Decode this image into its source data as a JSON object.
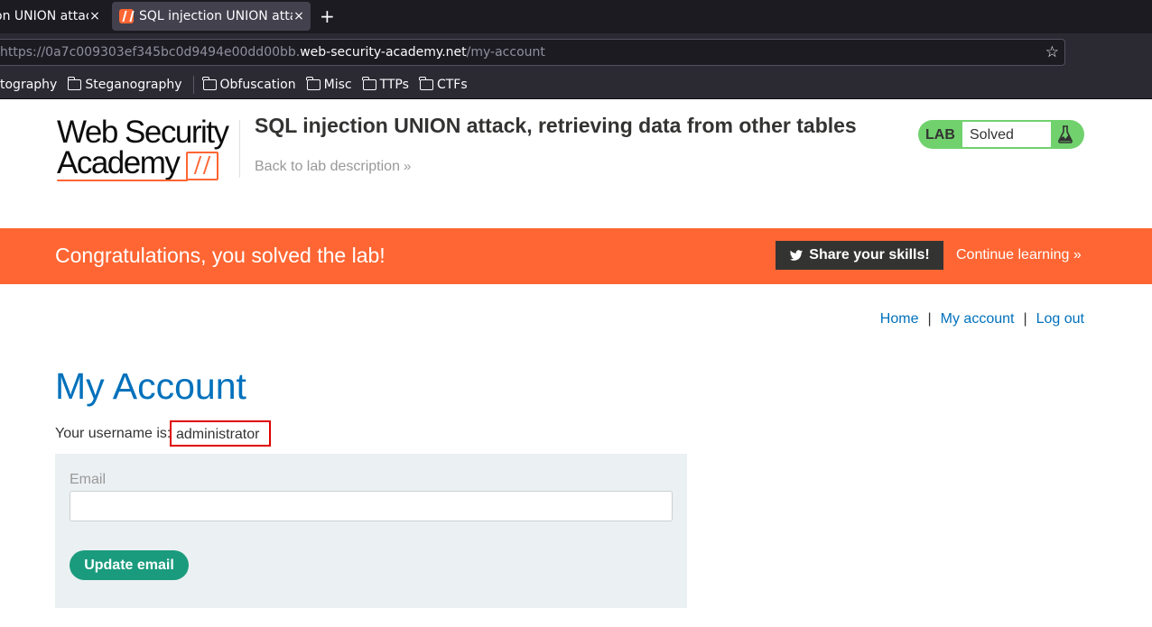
{
  "browser": {
    "tabs": [
      {
        "title": "on UNION attac",
        "active": false
      },
      {
        "title": "SQL injection UNION attac",
        "active": true
      }
    ],
    "new_tab_glyph": "+",
    "close_glyph": "×",
    "url": {
      "prefix": "https://0a7c009303ef345bc0d9494e00dd00bb.",
      "host": "web-security-academy.net",
      "path": "/my-account"
    },
    "bookmarks": [
      {
        "label": "tography",
        "folder": false
      },
      {
        "label": "Steganography",
        "folder": true
      },
      {
        "label": "Obfuscation",
        "folder": true
      },
      {
        "label": "Misc",
        "folder": true
      },
      {
        "label": "TTPs",
        "folder": true
      },
      {
        "label": "CTFs",
        "folder": true
      }
    ]
  },
  "header": {
    "logo": {
      "line1": "Web Security",
      "line2": "Academy"
    },
    "lab_title": "SQL injection UNION attack, retrieving data from other tables",
    "back_link": "Back to lab description",
    "back_chevron": "»",
    "lab_label": "LAB",
    "lab_status": "Solved",
    "status_color": "#70d16d"
  },
  "banner": {
    "message": "Congratulations, you solved the lab!",
    "share_label": "Share your skills!",
    "continue_label": "Continue learning",
    "continue_chevron": "»",
    "color": "#ff6633"
  },
  "nav": {
    "home": "Home",
    "account": "My account",
    "logout": "Log out",
    "separator": "|"
  },
  "account": {
    "heading": "My Account",
    "username_label": "Your username is:",
    "username": "administrator",
    "email_label": "Email",
    "email_value": "",
    "update_button": "Update email"
  },
  "colors": {
    "link": "#0071bc",
    "accent": "#ff6633",
    "button": "#1a9b7d",
    "highlight_box": "#e00000"
  }
}
